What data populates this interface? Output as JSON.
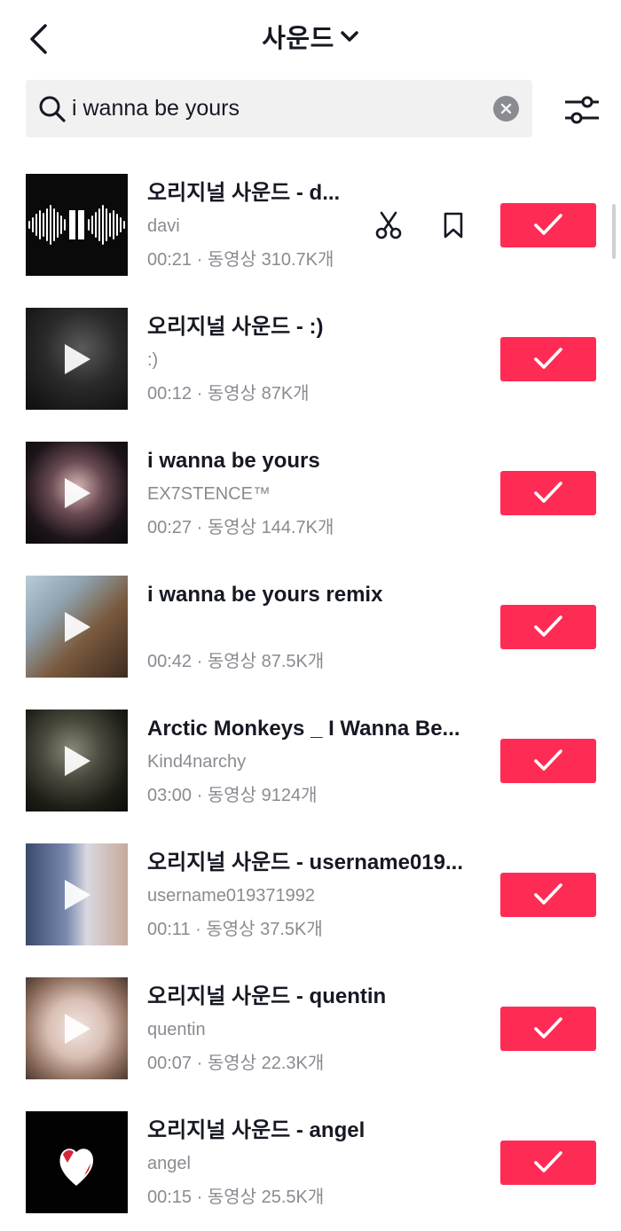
{
  "header": {
    "title": "사운드"
  },
  "search": {
    "value": "i wanna be yours"
  },
  "results": [
    {
      "title": "오리지널 사운드 - d...",
      "artist": "davi",
      "meta": "00:21 · 동영상 310.7K개"
    },
    {
      "title": "오리지널 사운드 - :)",
      "artist": ":)",
      "meta": "00:12 · 동영상 87K개"
    },
    {
      "title": "i wanna be yours",
      "artist": "EX7STENCE™",
      "meta": "00:27 · 동영상 144.7K개"
    },
    {
      "title": "i wanna be yours remix",
      "artist": "",
      "meta": "00:42 · 동영상 87.5K개"
    },
    {
      "title": "Arctic Monkeys _ I Wanna Be...",
      "artist": "Kind4narchy",
      "meta": "03:00 · 동영상 9124개"
    },
    {
      "title": "오리지널 사운드 - username019...",
      "artist": "username019371992",
      "meta": "00:11 · 동영상 37.5K개"
    },
    {
      "title": "오리지널 사운드 - quentin",
      "artist": "quentin",
      "meta": "00:07 · 동영상 22.3K개"
    },
    {
      "title": "오리지널 사운드 - angel",
      "artist": "angel",
      "meta": "00:15 · 동영상 25.5K개"
    }
  ],
  "colors": {
    "accent": "#fe2c55",
    "secondary_text": "#8a8b91",
    "search_bg": "#f1f1f2"
  },
  "icons": {
    "back": "chevron-left-icon",
    "title_dropdown": "chevron-down-icon",
    "search": "search-icon",
    "clear": "clear-icon",
    "filter": "filter-sliders-icon",
    "cut": "scissors-icon",
    "favorite": "bookmark-icon",
    "select": "check-icon",
    "play": "play-icon"
  }
}
